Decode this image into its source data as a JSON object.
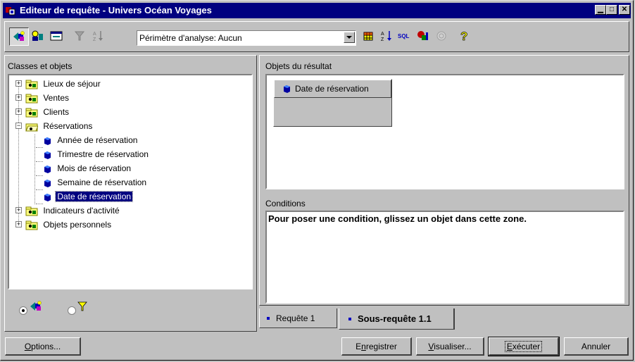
{
  "window": {
    "title": "Editeur de requête - Univers Océan Voyages"
  },
  "toolbar": {
    "scope_combo_value": "Périmètre d'analyse: Aucun"
  },
  "left_panel": {
    "title": "Classes et objets",
    "tree": [
      {
        "label": "Lieux de séjour"
      },
      {
        "label": "Ventes"
      },
      {
        "label": "Clients"
      },
      {
        "label": "Réservations"
      },
      {
        "label": "Année de réservation"
      },
      {
        "label": "Trimestre de réservation"
      },
      {
        "label": "Mois de réservation"
      },
      {
        "label": "Semaine de réservation"
      },
      {
        "label": "Date de réservation"
      },
      {
        "label": "Indicateurs d'activité"
      },
      {
        "label": "Objets personnels"
      }
    ]
  },
  "result": {
    "title": "Objets du résultat",
    "chip_label": "Date de réservation"
  },
  "conditions": {
    "title": "Conditions",
    "hint": "Pour poser une condition, glissez un objet dans cette zone."
  },
  "tabs": [
    {
      "label": "Requête 1"
    },
    {
      "label": "Sous-requête 1.1"
    }
  ],
  "buttons": {
    "options": {
      "u": "O",
      "rest": "ptions..."
    },
    "save": {
      "pre": "E",
      "u": "n",
      "rest": "registrer"
    },
    "visualize": {
      "u": "V",
      "rest": "isualiser..."
    },
    "execute": {
      "u": "E",
      "rest": "xécuter"
    },
    "cancel": "Annuler"
  },
  "colors": {
    "titlebar": "#000080",
    "selection": "#000080",
    "face": "#c0c0c0"
  }
}
